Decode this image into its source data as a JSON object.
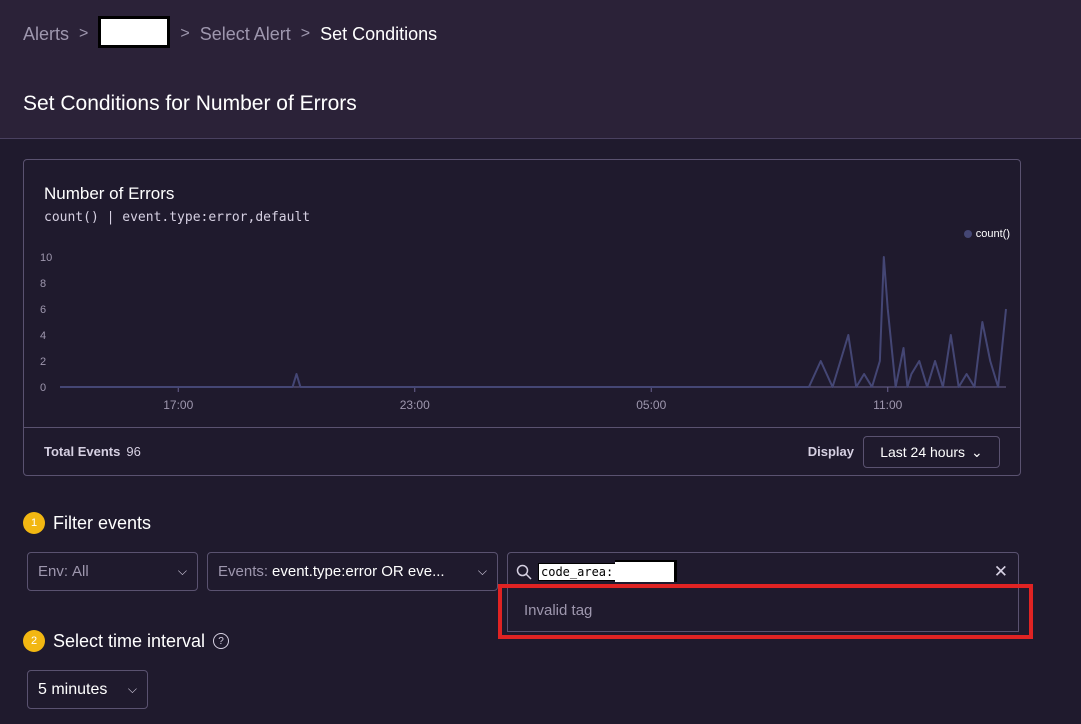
{
  "breadcrumbs": [
    "Alerts",
    "Select Alert",
    "Set Conditions"
  ],
  "page_title": "Set Conditions for Number of Errors",
  "chart_card": {
    "title": "Number of Errors",
    "query": "count() | event.type:error,default",
    "legend": "count()",
    "total_label": "Total Events",
    "total_value": "96",
    "display_label": "Display",
    "display_value": "Last 24 hours"
  },
  "chart_data": {
    "type": "line",
    "series": [
      {
        "name": "count()",
        "color": "#444674"
      }
    ],
    "x_ticks": [
      "17:00",
      "23:00",
      "05:00",
      "11:00"
    ],
    "y_ticks": [
      "0",
      "2",
      "4",
      "6",
      "8",
      "10"
    ],
    "ylim": [
      0,
      10
    ],
    "x_hours": [
      0,
      5.9,
      6.0,
      6.1,
      18.0,
      19.0,
      19.3,
      19.6,
      19.8,
      20.0,
      20.2,
      20.4,
      20.6,
      20.8,
      20.9,
      21.0,
      21.2,
      21.4,
      21.5,
      21.6,
      21.8,
      22.0,
      22.2,
      22.4,
      22.6,
      22.8,
      23.0,
      23.2,
      23.4,
      23.6,
      23.8,
      24.0
    ],
    "y_values": [
      0,
      0,
      1,
      0,
      0,
      0,
      2,
      0,
      2,
      4,
      0,
      1,
      0,
      2,
      10,
      6,
      0,
      3,
      0,
      1,
      2,
      0,
      2,
      0,
      4,
      0,
      1,
      0,
      5,
      2,
      0,
      6
    ],
    "x_start_hour": 13.0
  },
  "step1": {
    "num": "1",
    "label": "Filter events"
  },
  "step2": {
    "num": "2",
    "label": "Select time interval"
  },
  "env_select": {
    "key": "Env:",
    "value": "All"
  },
  "events_select": {
    "key": "Events:",
    "value": "event.type:error OR eve..."
  },
  "search": {
    "token": "code_area:",
    "error": "Invalid tag"
  },
  "interval_select": {
    "value": "5 minutes"
  }
}
